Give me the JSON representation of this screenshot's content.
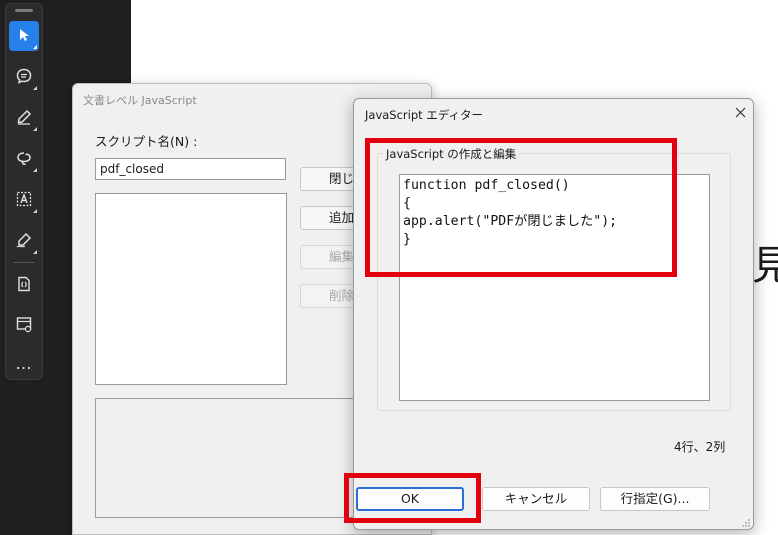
{
  "background": {
    "partial_char": "見"
  },
  "toolbar": {
    "tools": [
      {
        "name": "select-tool",
        "icon": "cursor-arrow-icon",
        "active": true
      },
      {
        "name": "comment-tool",
        "icon": "speech-bubble-icon"
      },
      {
        "name": "draw-tool",
        "icon": "pen-icon"
      },
      {
        "name": "freehand-tool",
        "icon": "lasso-icon"
      },
      {
        "name": "text-tool",
        "icon": "text-box-icon"
      },
      {
        "name": "sign-tool",
        "icon": "signature-pen-icon"
      },
      {
        "name": "convert-tool",
        "icon": "document-convert-icon"
      },
      {
        "name": "organize-tool",
        "icon": "page-settings-icon"
      },
      {
        "name": "more-tools",
        "icon": "more-ellipsis-icon"
      }
    ],
    "more_label": "…"
  },
  "doc_dialog": {
    "title": "文書レベル JavaScript",
    "script_name_label": "スクリプト名(N) :",
    "script_name_value": "pdf_closed",
    "buttons": {
      "close": "閉じる",
      "add": "追加",
      "edit": "編集",
      "delete": "削除"
    }
  },
  "js_editor": {
    "title": "JavaScript エディター",
    "group_label": "JavaScript の作成と編集",
    "code_lines": [
      "function pdf_closed()",
      "{",
      "app.alert(\"PDFが閉じました\");",
      "}"
    ],
    "cursor_position": "4行、2列",
    "buttons": {
      "ok": "OK",
      "cancel": "キャンセル",
      "goto_line": "行指定(G)..."
    }
  },
  "colors": {
    "highlight": "#e3000f",
    "accent": "#2680eb",
    "ok_border": "#2a6fd6"
  }
}
